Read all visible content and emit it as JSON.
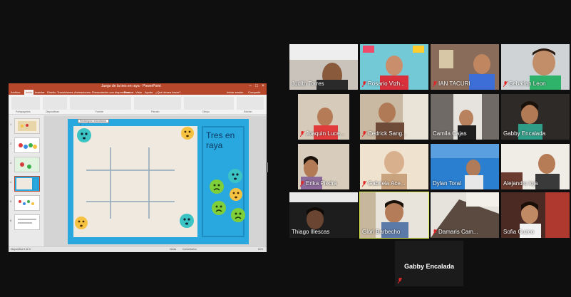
{
  "powerpoint": {
    "window_title": "Juego de la tres en raya - PowerPoint",
    "menu": [
      "Archivo",
      "Inicio",
      "Insertar",
      "Diseño",
      "Transiciones",
      "Animaciones",
      "Presentación con diapositivas",
      "Revisar",
      "Vista",
      "Ayuda",
      "¿Qué desea hacer?"
    ],
    "active_menu": "Inicio",
    "account": "Iniciar sesión",
    "share": "Compartir",
    "ribbon_groups": [
      "Portapapeles",
      "Diapositivas",
      "Fuente",
      "Párrafo",
      "Dibujo",
      "Edición"
    ],
    "slide_count": 6,
    "selected_slide": 5,
    "selection_label": "Rectángulo redondeado 4",
    "slide_side_title": "Tres en raya",
    "status_left": "Diapositiva 5 de 6",
    "status_notes": "Notas",
    "status_comments": "Comentarios",
    "zoom": "61%"
  },
  "participants": [
    {
      "name": "Judith Torres",
      "muted": false
    },
    {
      "name": "Rosario Vizh...",
      "muted": true
    },
    {
      "name": "IAN TACURI",
      "muted": true
    },
    {
      "name": "Sebatian Leon",
      "muted": true
    },
    {
      "name": "Joaquin Luce...",
      "muted": true
    },
    {
      "name": "Cedrick Sang...",
      "muted": true
    },
    {
      "name": "Camila Cajas",
      "muted": false
    },
    {
      "name": "Gabby Encalada",
      "muted": false
    },
    {
      "name": "Erika Piedra",
      "muted": true
    },
    {
      "name": "Gabriela Ace...",
      "muted": true
    },
    {
      "name": "Dylan Toral",
      "muted": false
    },
    {
      "name": "Alejandro loja",
      "muted": false
    },
    {
      "name": "Thiago Illescas",
      "muted": false
    },
    {
      "name": "Glori Barbecho",
      "muted": false
    },
    {
      "name": "Damaris Cam...",
      "muted": true
    },
    {
      "name": "Sofia Cuzco",
      "muted": false
    }
  ],
  "active_speaker": "Glori Barbecho",
  "spotlight": {
    "name": "Gabby Encalada",
    "muted": true
  },
  "colors": {
    "ppt_brand": "#b7472a",
    "slide_blue": "#29a7df",
    "active_outline": "#d7e84a",
    "mute_red": "#e02828"
  }
}
